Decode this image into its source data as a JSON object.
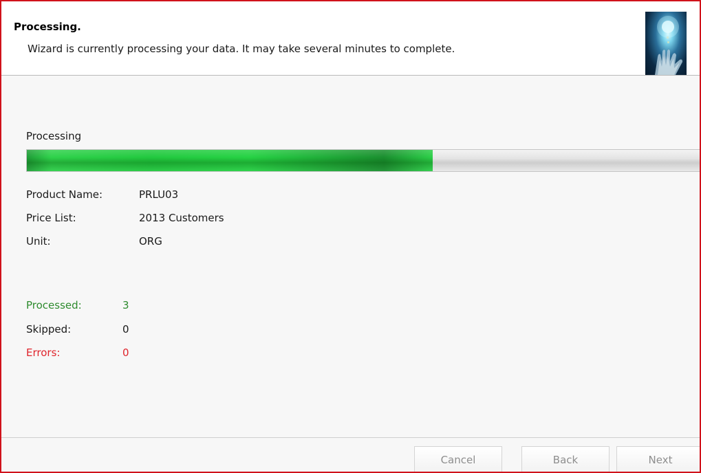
{
  "header": {
    "title": "Processing.",
    "subtitle": "Wizard is currently processing your data. It may take several minutes to complete."
  },
  "progress": {
    "label": "Processing",
    "fraction": 0.6
  },
  "details": [
    {
      "label": "Product Name:",
      "value": "PRLU03"
    },
    {
      "label": "Price List:",
      "value": "2013 Customers"
    },
    {
      "label": "Unit:",
      "value": "ORG"
    }
  ],
  "stats": {
    "processed": {
      "label": "Processed:",
      "value": "3",
      "color": "#2e8b2e"
    },
    "skipped": {
      "label": "Skipped:",
      "value": "0",
      "color": "#1a1a1a"
    },
    "errors": {
      "label": "Errors:",
      "value": "0",
      "color": "#e0242c"
    }
  },
  "buttons": {
    "cancel": "Cancel",
    "back": "Back",
    "next": "Next"
  },
  "colors": {
    "window_border": "#d0121b",
    "progress_green": "#22c93f"
  },
  "icons": {
    "header_image": "glowing-hand-image"
  }
}
